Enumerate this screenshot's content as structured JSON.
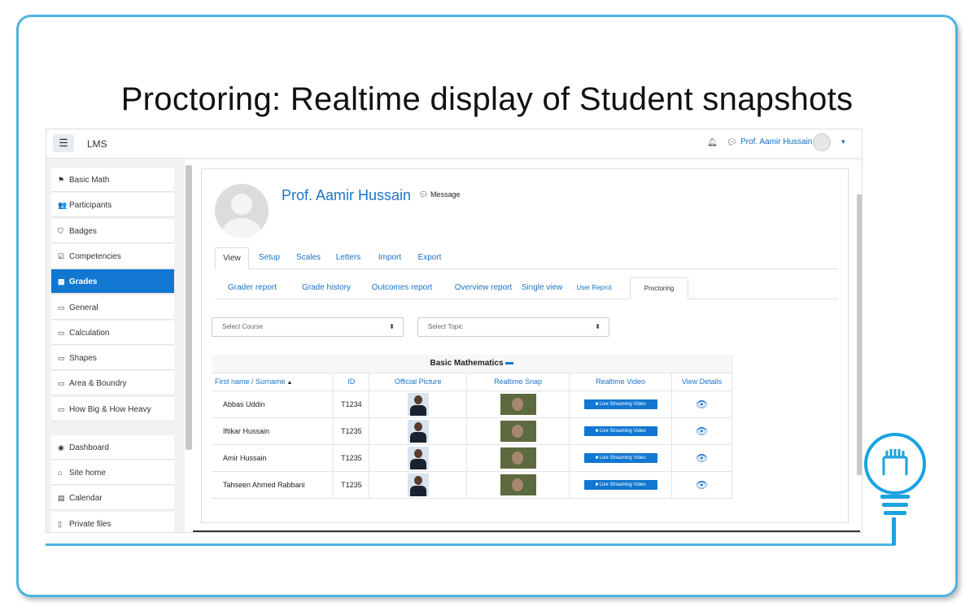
{
  "slide": {
    "title": "Proctoring: Realtime display of Student snapshots"
  },
  "topbar": {
    "menu_icon": "☰",
    "brand": "LMS",
    "user_name": "Prof. Aamir Hussain"
  },
  "sidebar": {
    "items": [
      {
        "icon": "⚑",
        "label": "Basic Math",
        "active": false
      },
      {
        "icon": "👥",
        "label": "Participants",
        "active": false
      },
      {
        "icon": "⛉",
        "label": "Badges",
        "active": false
      },
      {
        "icon": "☑",
        "label": "Competencies",
        "active": false
      },
      {
        "icon": "▦",
        "label": "Grades",
        "active": true
      },
      {
        "icon": "▭",
        "label": "General",
        "active": false
      },
      {
        "icon": "▭",
        "label": "Calculation",
        "active": false
      },
      {
        "icon": "▭",
        "label": "Shapes",
        "active": false
      },
      {
        "icon": "▭",
        "label": "Area & Boundry",
        "active": false
      },
      {
        "icon": "▭",
        "label": "How Big & How Heavy",
        "active": false
      },
      {
        "icon": "◉",
        "label": "Dashboard",
        "active": false
      },
      {
        "icon": "⌂",
        "label": "Site home",
        "active": false
      },
      {
        "icon": "▤",
        "label": "Calendar",
        "active": false
      },
      {
        "icon": "▯",
        "label": "Private files",
        "active": false
      }
    ]
  },
  "profile": {
    "name": "Prof. Aamir Hussain",
    "message_label": "Message"
  },
  "tabs_primary": [
    "View",
    "Setup",
    "Scales",
    "Letters",
    "Import",
    "Export"
  ],
  "tabs_secondary": [
    "Grader report",
    "Grade history",
    "Outcomes report",
    "Overview report",
    "Single view",
    "User Reprot",
    "Proctoring"
  ],
  "filters": {
    "course_placeholder": "Select Course",
    "topic_placeholder": "Select Topic"
  },
  "table": {
    "caption": "Basic Mathematics",
    "headers": [
      "First name / Surname",
      "ID",
      "Official Picture",
      "Realtime Snap",
      "Realtime Video",
      "View Details"
    ],
    "live_label": "Live Streaming Video",
    "rows": [
      {
        "name": "Abbas Uddin",
        "id": "T1234"
      },
      {
        "name": "Iftikar Hussain",
        "id": "T1235"
      },
      {
        "name": "Amir Hussain",
        "id": "T1235"
      },
      {
        "name": "Tahseen Ahmed Rabbani",
        "id": "T1235"
      }
    ]
  },
  "colors": {
    "accent": "#1177d1",
    "slide_border": "#4fb3df"
  }
}
